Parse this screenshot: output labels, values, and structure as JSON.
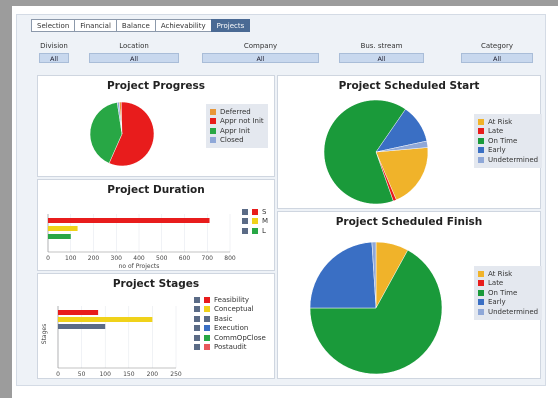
{
  "tabs": [
    {
      "label": "Selection",
      "active": false
    },
    {
      "label": "Financial",
      "active": false
    },
    {
      "label": "Balance",
      "active": false
    },
    {
      "label": "Achievability",
      "active": false
    },
    {
      "label": "Projects",
      "active": true
    }
  ],
  "filters": [
    {
      "label": "Division",
      "value": "All"
    },
    {
      "label": "Location",
      "value": "All"
    },
    {
      "label": "Company",
      "value": "All"
    },
    {
      "label": "Bus. stream",
      "value": "All"
    },
    {
      "label": "Category",
      "value": "All"
    }
  ],
  "colors": {
    "orange": "#e8973a",
    "red": "#e81c1c",
    "green": "#28a745",
    "blue": "#3a6fc4",
    "lightblue": "#8fa8d8",
    "yellow": "#f0d21a",
    "amber": "#f0b32a",
    "darkgreen": "#1a9a3a",
    "slate": "#5b6b86"
  },
  "chart_data": [
    {
      "type": "pie",
      "title": "Project Progress",
      "legend": [
        {
          "label": "Deferred",
          "color": "#e8973a"
        },
        {
          "label": "Appr not Init",
          "color": "#e81c1c"
        },
        {
          "label": "Appr Init",
          "color": "#28a745"
        },
        {
          "label": "Closed",
          "color": "#8fa8d8"
        }
      ],
      "values": [
        1,
        57,
        41,
        1
      ]
    },
    {
      "type": "bar",
      "title": "Project Duration",
      "xlabel": "no of Projects",
      "xticks": [
        "0",
        "100",
        "200",
        "300",
        "400",
        "500",
        "600",
        "700",
        "800"
      ],
      "xlim": [
        0,
        800
      ],
      "legend": [
        {
          "label": "S",
          "color": "#e81c1c"
        },
        {
          "label": "M",
          "color": "#f0d21a"
        },
        {
          "label": "L",
          "color": "#28a745"
        }
      ],
      "values": [
        710,
        130,
        100
      ]
    },
    {
      "type": "bar",
      "title": "Project Stages",
      "ylabel": "Stages",
      "xticks": [
        "0",
        "50",
        "100",
        "150",
        "200",
        "250"
      ],
      "xlim": [
        0,
        250
      ],
      "legend": [
        {
          "label": "Feasibility",
          "color": "#e81c1c"
        },
        {
          "label": "Conceptual",
          "color": "#f0d21a"
        },
        {
          "label": "Basic",
          "color": "#5b6b86"
        },
        {
          "label": "Execution",
          "color": "#3a6fc4"
        },
        {
          "label": "CommOpClose",
          "color": "#28a745"
        },
        {
          "label": "Postaudit",
          "color": "#e8575a"
        }
      ],
      "values": [
        85,
        200,
        100,
        0,
        0,
        0
      ]
    },
    {
      "type": "pie",
      "title": "Project Scheduled Start",
      "legend": [
        {
          "label": "At Risk",
          "color": "#f0b32a"
        },
        {
          "label": "Late",
          "color": "#e81c1c"
        },
        {
          "label": "On Time",
          "color": "#1a9a3a"
        },
        {
          "label": "Early",
          "color": "#3a6fc4"
        },
        {
          "label": "Undetermined",
          "color": "#8fa8d8"
        }
      ],
      "values": [
        20,
        1,
        65,
        12,
        2
      ]
    },
    {
      "type": "pie",
      "title": "Project Scheduled Finish",
      "legend": [
        {
          "label": "At Risk",
          "color": "#f0b32a"
        },
        {
          "label": "Late",
          "color": "#e81c1c"
        },
        {
          "label": "On Time",
          "color": "#1a9a3a"
        },
        {
          "label": "Early",
          "color": "#3a6fc4"
        },
        {
          "label": "Undetermined",
          "color": "#8fa8d8"
        }
      ],
      "values": [
        8,
        0,
        67,
        24,
        1
      ]
    }
  ]
}
